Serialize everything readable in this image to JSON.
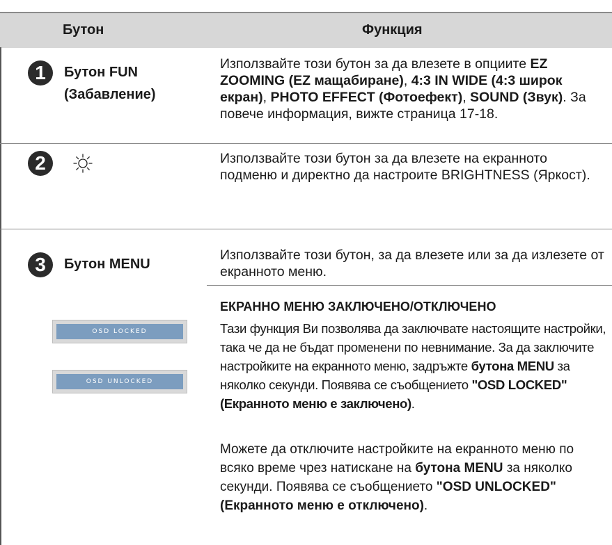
{
  "header": {
    "button_col": "Бутон",
    "function_col": "Функция"
  },
  "rows": [
    {
      "number": "1",
      "label_line1": "Бутон FUN",
      "label_line2": "(Забавление)",
      "desc": [
        {
          "t": "Използвайте този бутон за да влезете в опциите ",
          "b": false
        },
        {
          "t": "EZ ZOOMING (EZ мащабиране)",
          "b": true
        },
        {
          "t": ", ",
          "b": false
        },
        {
          "t": "4:3 IN WIDE (4:3 широк екран)",
          "b": true
        },
        {
          "t": ", ",
          "b": false
        },
        {
          "t": "PHOTO EFFECT (Фотоефект)",
          "b": true
        },
        {
          "t": ", ",
          "b": false
        },
        {
          "t": "SOUND (Звук)",
          "b": true
        },
        {
          "t": ". За повече информация, вижте страница 17-18.",
          "b": false
        }
      ]
    },
    {
      "number": "2",
      "icon": "brightness-sun-icon",
      "desc": [
        {
          "t": "Използвайте този бутон за да влезете на екранното подменю и директно да настроите BRIGHTNESS (Яркост).",
          "b": false
        }
      ]
    },
    {
      "number": "3",
      "label": "Бутон MENU",
      "desc": [
        {
          "t": "Използвайте този бутон, за да влезете или за да излезете от екранното меню.",
          "b": false
        }
      ]
    }
  ],
  "osd_section": {
    "title": "ЕКРАННО МЕНЮ ЗАКЛЮЧЕНО/ОТКЛЮЧЕНО",
    "locked_label": "OSD LOCKED",
    "unlocked_label": "OSD UNLOCKED",
    "para1": [
      {
        "t": "Тази функция Ви позволява да заключвате настоящите настройки, така че да не бъдат променени по невнимание. За да заключите настройките на екранното меню, задръжте ",
        "b": false
      },
      {
        "t": "бутона MENU",
        "b": true
      },
      {
        "t": " за няколко секунди. Появява се съобщението ",
        "b": false
      },
      {
        "t": "\"OSD LOCKED\" (Екранното меню е заключено)",
        "b": true
      },
      {
        "t": ".",
        "b": false
      }
    ],
    "para2": [
      {
        "t": "Можете да отключите настройките на екранното меню по всяко време чрез натискане на ",
        "b": false
      },
      {
        "t": "бутона MENU",
        "b": true
      },
      {
        "t": " за няколко секунди. Появява се съобщението ",
        "b": false
      },
      {
        "t": "\"OSD UNLOCKED\" (Екранното меню е отключено)",
        "b": true
      },
      {
        "t": ".",
        "b": false
      }
    ]
  }
}
